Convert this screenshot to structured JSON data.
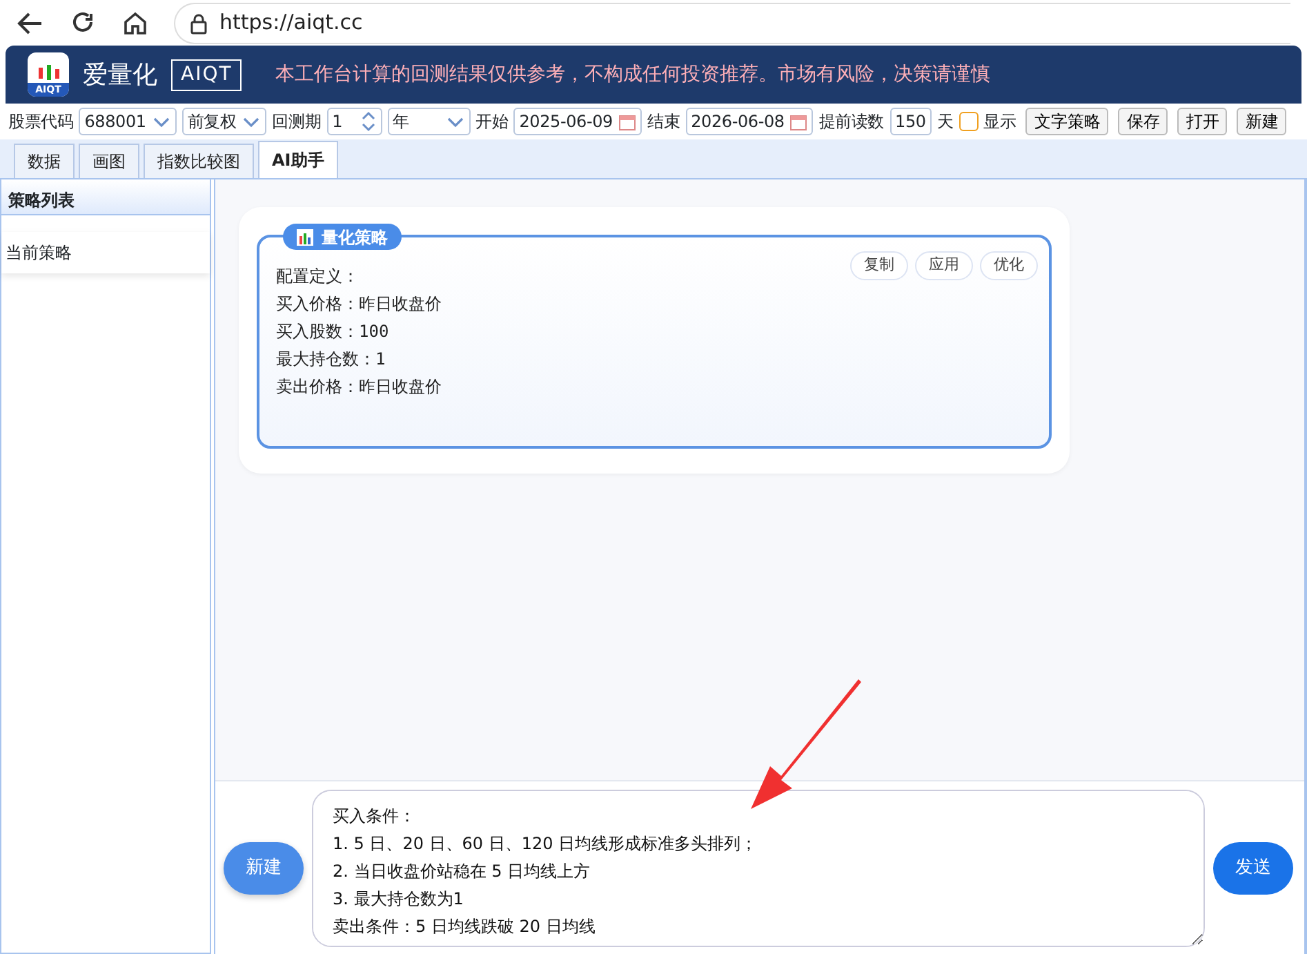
{
  "browser": {
    "url": "https://aiqt.cc"
  },
  "header": {
    "logo_caption": "AIQT",
    "brand": "爱量化",
    "brand_badge": "AIQT",
    "notice": "本工作台计算的回测结果仅供参考，不构成任何投资推荐。市场有风险，决策请谨慎"
  },
  "toolbar": {
    "items": [
      {
        "kind": "label",
        "text": "股票代码"
      },
      {
        "kind": "select",
        "value": "688001"
      },
      {
        "kind": "select",
        "value": "前复权"
      },
      {
        "kind": "label",
        "text": "回测期"
      },
      {
        "kind": "spin",
        "value": "1"
      },
      {
        "kind": "select",
        "value": "年"
      },
      {
        "kind": "label",
        "text": "开始"
      },
      {
        "kind": "date",
        "value": "2025-06-09"
      },
      {
        "kind": "label",
        "text": "结束"
      },
      {
        "kind": "date",
        "value": "2026-06-08"
      },
      {
        "kind": "label",
        "text": "提前读数"
      },
      {
        "kind": "number",
        "value": "150"
      },
      {
        "kind": "label",
        "text": "天"
      },
      {
        "kind": "check",
        "text": "显示",
        "checked": false
      },
      {
        "kind": "button",
        "text": "文字策略"
      },
      {
        "kind": "button",
        "text": "保存"
      },
      {
        "kind": "button",
        "text": "打开"
      },
      {
        "kind": "button",
        "text": "新建"
      }
    ]
  },
  "tabs": [
    {
      "label": "数据",
      "selected": false
    },
    {
      "label": "画图",
      "selected": false
    },
    {
      "label": "指数比较图",
      "selected": false
    },
    {
      "label": "AI助手",
      "selected": true
    }
  ],
  "sidebar": {
    "title": "策略列表",
    "items": [
      {
        "label": "当前策略"
      }
    ]
  },
  "strategy_card": {
    "title": "量化策略",
    "actions": [
      "复制",
      "应用",
      "优化"
    ],
    "lines": [
      "配置定义：",
      "买入价格：昨日收盘价",
      "买入股数：100",
      "最大持仓数：1",
      "卖出价格：昨日收盘价"
    ]
  },
  "composer": {
    "new_button": "新建",
    "value": "买入条件：\n1. 5 日、20 日、60 日、120 日均线形成标准多头排列；\n2. 当日收盘价站稳在 5 日均线上方\n3. 最大持仓数为1\n卖出条件：5 日均线跌破 20 日均线",
    "send_button": "发送"
  }
}
